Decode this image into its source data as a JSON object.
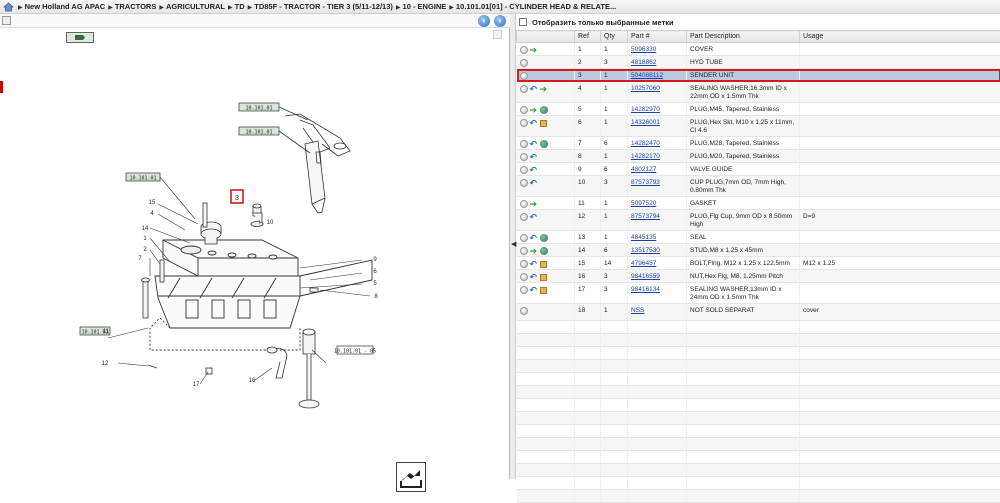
{
  "breadcrumbs": [
    "New Holland AG APAC",
    "TRACTORS",
    "AGRICULTURAL",
    "TD",
    "TD85F - TRACTOR - TIER 3 (5/11-12/13)",
    "10 - ENGINE",
    "10.101.01[01] - CYLINDER HEAD & RELATE..."
  ],
  "filter_label": "Отобразить только выбранные метки",
  "table": {
    "headers": [
      "",
      "Ref",
      "Qty",
      "Part #",
      "Part Description",
      "Usage"
    ],
    "rows": [
      {
        "icons": [
          "info",
          "green"
        ],
        "ref": "1",
        "qty": "1",
        "part": "5096330",
        "desc": "COVER",
        "usage": ""
      },
      {
        "icons": [
          "info"
        ],
        "ref": "2",
        "qty": "3",
        "part": "4818862",
        "desc": "HYD TUBE",
        "usage": ""
      },
      {
        "icons": [
          "info"
        ],
        "ref": "3",
        "qty": "1",
        "part": "504088112",
        "desc": "SENDER UNIT",
        "usage": "",
        "selected": true
      },
      {
        "icons": [
          "info",
          "blue",
          "green"
        ],
        "ref": "4",
        "qty": "1",
        "part": "10257060",
        "desc": "SEALING WASHER,16.3mm ID x 22mm OD x 1.5mm Thk",
        "usage": ""
      },
      {
        "icons": [
          "info",
          "green",
          "globe"
        ],
        "ref": "5",
        "qty": "1",
        "part": "14282970",
        "desc": "PLUG,M45, Tapered, Stainless",
        "usage": ""
      },
      {
        "icons": [
          "info",
          "blue",
          "box"
        ],
        "ref": "6",
        "qty": "1",
        "part": "14326001",
        "desc": "PLUG,Hex Skt, M10 x 1.25 x 11mm, Cl 4.6",
        "usage": ""
      },
      {
        "icons": [
          "info",
          "blue",
          "globe"
        ],
        "ref": "7",
        "qty": "6",
        "part": "14282470",
        "desc": "PLUG,M28, Tapered, Stainless",
        "usage": ""
      },
      {
        "icons": [
          "info",
          "blue"
        ],
        "ref": "8",
        "qty": "1",
        "part": "14282170",
        "desc": "PLUG,M20, Tapered, Stainless",
        "usage": ""
      },
      {
        "icons": [
          "info",
          "blue"
        ],
        "ref": "9",
        "qty": "6",
        "part": "4802127",
        "desc": "VALVE GUIDE",
        "usage": ""
      },
      {
        "icons": [
          "info",
          "blue"
        ],
        "ref": "10",
        "qty": "3",
        "part": "87573793",
        "desc": "CUP PLUG,7mm OD, 7mm High, 0.80mm Thk",
        "usage": ""
      },
      {
        "icons": [
          "info",
          "green"
        ],
        "ref": "11",
        "qty": "1",
        "part": "5097520",
        "desc": "GASKET",
        "usage": ""
      },
      {
        "icons": [
          "info",
          "blue"
        ],
        "ref": "12",
        "qty": "1",
        "part": "87573794",
        "desc": "PLUG,Flg Cup, 9mm OD x 8.50mm High",
        "usage": "D=9"
      },
      {
        "icons": [
          "info",
          "blue",
          "globe"
        ],
        "ref": "13",
        "qty": "1",
        "part": "4845135",
        "desc": "SEAL",
        "usage": ""
      },
      {
        "icons": [
          "info",
          "green",
          "globe"
        ],
        "ref": "14",
        "qty": "6",
        "part": "13517530",
        "desc": "STUD,M8 x 1.25 x 45mm",
        "usage": ""
      },
      {
        "icons": [
          "info",
          "blue",
          "box"
        ],
        "ref": "15",
        "qty": "14",
        "part": "4796457",
        "desc": "BOLT,Flng, M12 x 1.25 x 122.5mm",
        "usage": "M12 x 1.25"
      },
      {
        "icons": [
          "info",
          "blue",
          "box"
        ],
        "ref": "16",
        "qty": "3",
        "part": "98416559",
        "desc": "NUT,Hex Flg, M8, 1.25mm Pitch",
        "usage": ""
      },
      {
        "icons": [
          "info",
          "blue",
          "box"
        ],
        "ref": "17",
        "qty": "3",
        "part": "98416134",
        "desc": "SEALING WASHER,13mm ID x 24mm OD x 1.5mm Thk",
        "usage": ""
      },
      {
        "icons": [
          "info"
        ],
        "ref": "18",
        "qty": "1",
        "part": "NSS",
        "desc": "NOT SOLD SEPARAT",
        "usage": "cover"
      }
    ]
  },
  "diagram": {
    "callouts": [
      "15",
      "4",
      "14",
      "1",
      "2",
      "7",
      "11",
      "9",
      "6",
      "3",
      "5",
      "8",
      "10",
      "17",
      "16",
      "12",
      "13",
      "18"
    ],
    "plate_labels": [
      "10.101.01",
      "10.101.01",
      "10.101.01",
      "10.101.01",
      "10.101.01",
      "10.101.01 - 05"
    ]
  }
}
